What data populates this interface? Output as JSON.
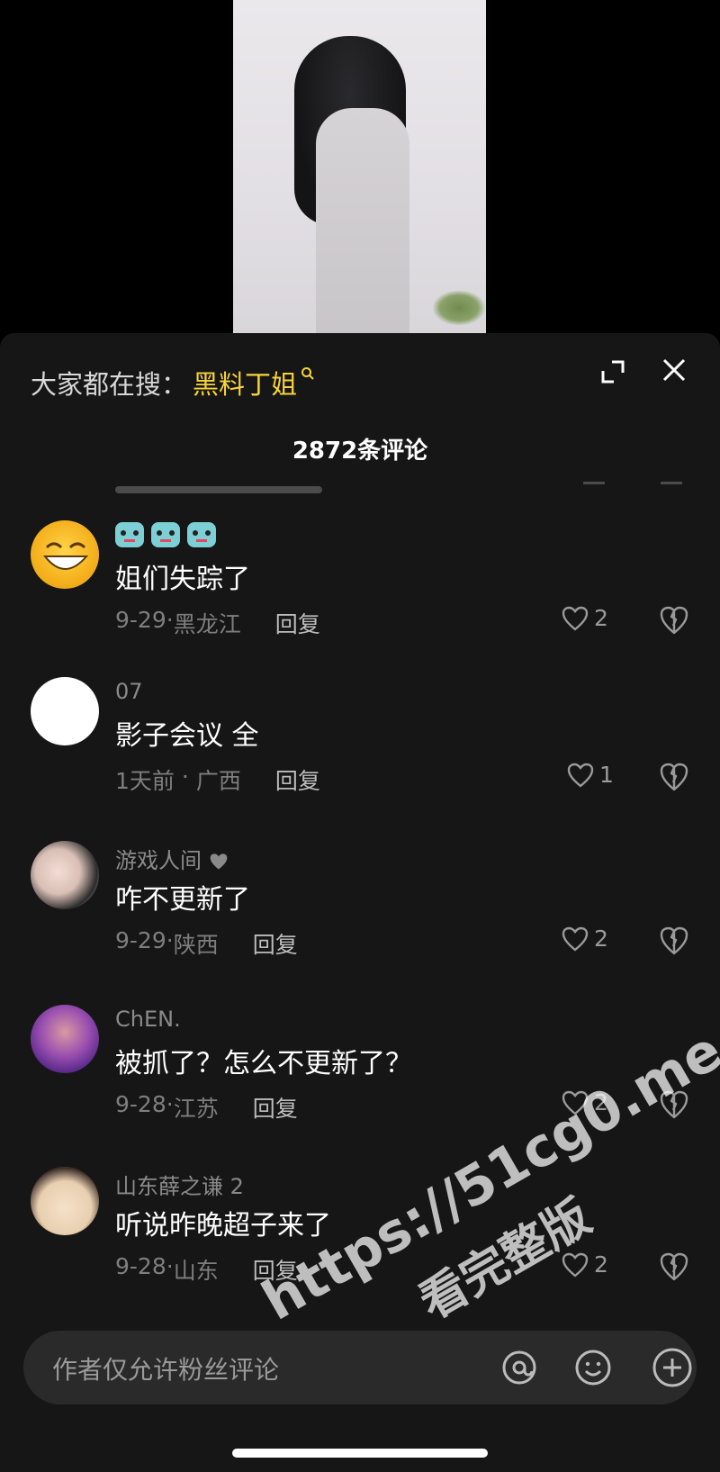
{
  "header": {
    "search_prefix": "大家都在搜：",
    "search_term": "黑料丁姐",
    "comment_count": "2872条评论"
  },
  "comments": [
    {
      "username_emoji": [
        "robot-emoji",
        "robot-emoji",
        "robot-emoji"
      ],
      "text": "姐们失踪了",
      "date": "9-29",
      "location": "黑龙江",
      "reply": "回复",
      "likes": "2"
    },
    {
      "username": "07",
      "text": "影子会议 全",
      "date": "1天前",
      "location": "广西",
      "reply": "回复",
      "likes": "1"
    },
    {
      "username": "游戏人间",
      "text": "咋不更新了",
      "date": "9-29",
      "location": "陕西",
      "reply": "回复",
      "likes": "2"
    },
    {
      "username": "ChEN.",
      "text": "被抓了？怎么不更新了？",
      "date": "9-28",
      "location": "江苏",
      "reply": "回复",
      "likes": "2"
    },
    {
      "username": "山东薛之谦 2",
      "text": "听说昨晚超子来了",
      "date": "9-28",
      "location": "山东",
      "reply": "回复",
      "likes": "2"
    }
  ],
  "separator": "·",
  "input": {
    "placeholder": "作者仅允许粉丝评论"
  },
  "watermark": {
    "url": "https://51cg0.me",
    "subtitle": "看完整版"
  },
  "colors": {
    "sheet_bg": "#161616",
    "search_highlight": "#f7d338",
    "input_bg": "#2a2a2a"
  }
}
